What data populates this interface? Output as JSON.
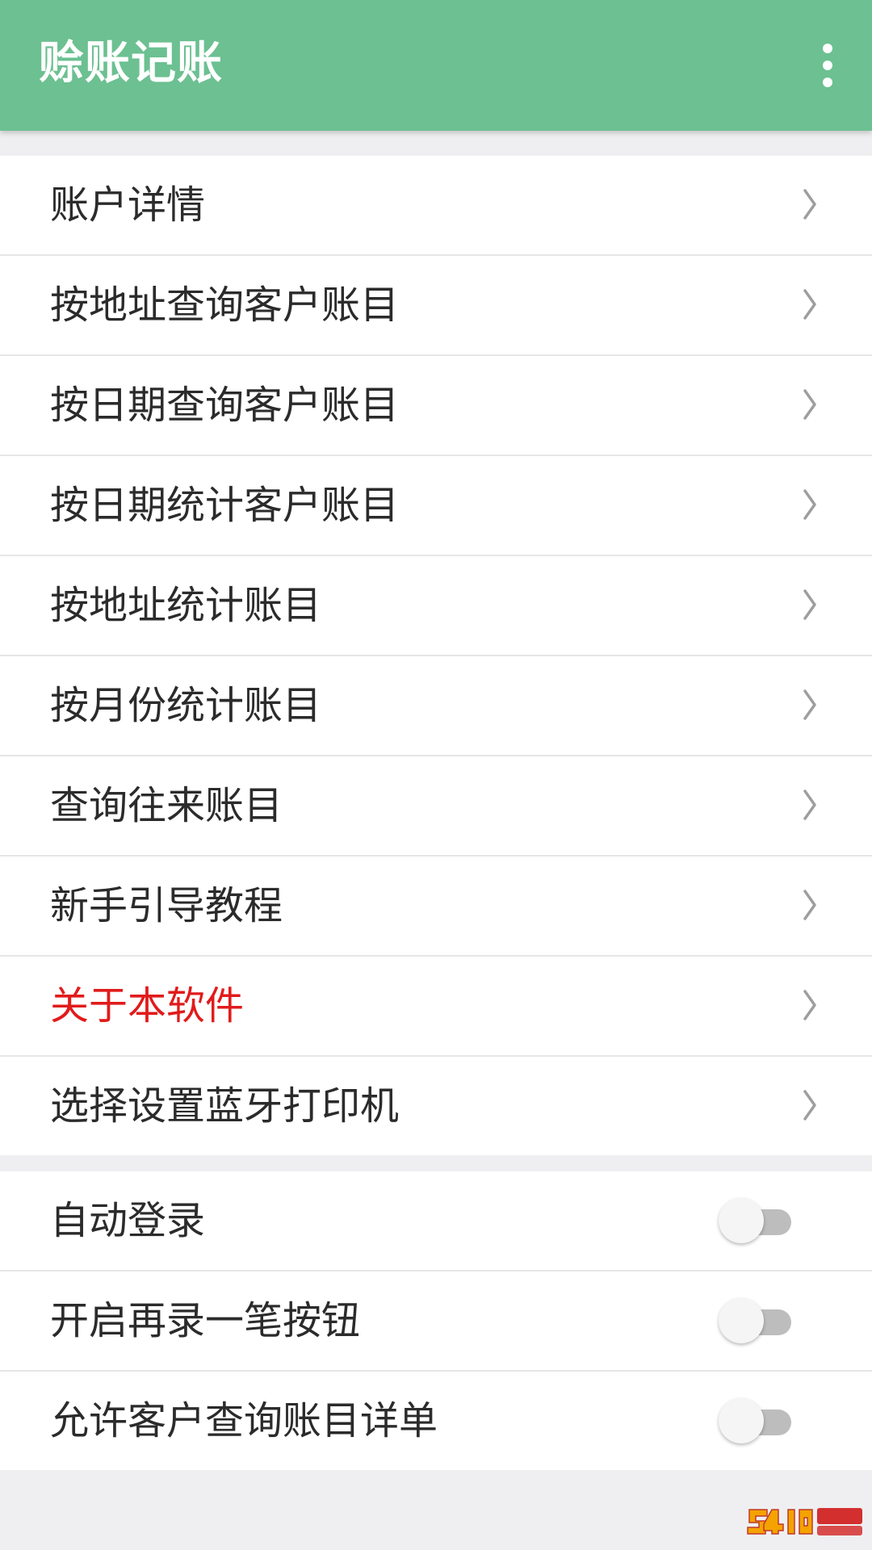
{
  "app_bar": {
    "title": "赊账记账",
    "menu_icon": "more-vertical-icon"
  },
  "nav_items": [
    {
      "label": "账户详情"
    },
    {
      "label": "按地址查询客户账目"
    },
    {
      "label": "按日期查询客户账目"
    },
    {
      "label": "按日期统计客户账目"
    },
    {
      "label": "按地址统计账目"
    },
    {
      "label": "按月份统计账目"
    },
    {
      "label": "查询往来账目"
    },
    {
      "label": "新手引导教程"
    },
    {
      "label": "关于本软件",
      "color": "#e11b1b"
    },
    {
      "label": "选择设置蓝牙打印机"
    }
  ],
  "settings": [
    {
      "label": "自动登录",
      "enabled": false
    },
    {
      "label": "开启再录一笔按钮",
      "enabled": false
    },
    {
      "label": "允许客户查询账目详单",
      "enabled": false
    }
  ],
  "colors": {
    "app_bar": "#6cc091",
    "background": "#efeff1",
    "accent_red": "#e11b1b"
  }
}
